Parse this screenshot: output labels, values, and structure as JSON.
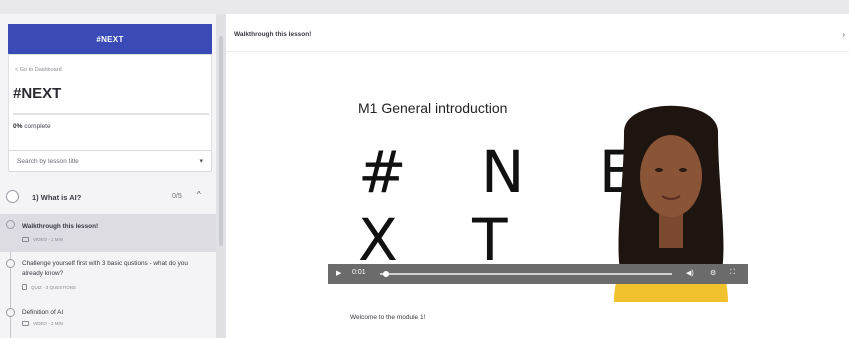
{
  "sidebar": {
    "brand": "#NEXT",
    "back_link": "< Go to Dashboard",
    "course_title": "#NEXT",
    "progress_percent": 0,
    "progress_value": "0%",
    "progress_suffix": "complete",
    "search_placeholder": "Search by lesson title",
    "section": {
      "title": "1) What is AI?",
      "count": "0/5"
    },
    "lessons": [
      {
        "title": "Walkthrough this lesson!",
        "meta": "VIDEO - 1 MIN",
        "active": true
      },
      {
        "title": "Challenge yourself first with 3 basic qustions - what do you already know?",
        "meta": "QUIZ - 3 QUESTIONS",
        "active": false
      },
      {
        "title": "Definition of AI",
        "meta": "VIDEO - 2 MIN",
        "active": false
      }
    ]
  },
  "main": {
    "lesson_title": "Walkthrough this lesson!",
    "slide_heading": "M1 General introduction",
    "slide_logo": "# N E X T",
    "video": {
      "time": "0:01",
      "progress": 0.02
    },
    "welcome_text": "Welcome to the module 1!"
  },
  "colors": {
    "brand": "#3a4bb8",
    "controls": "#6b6b6b",
    "presenter_top": "#f2c12e"
  }
}
